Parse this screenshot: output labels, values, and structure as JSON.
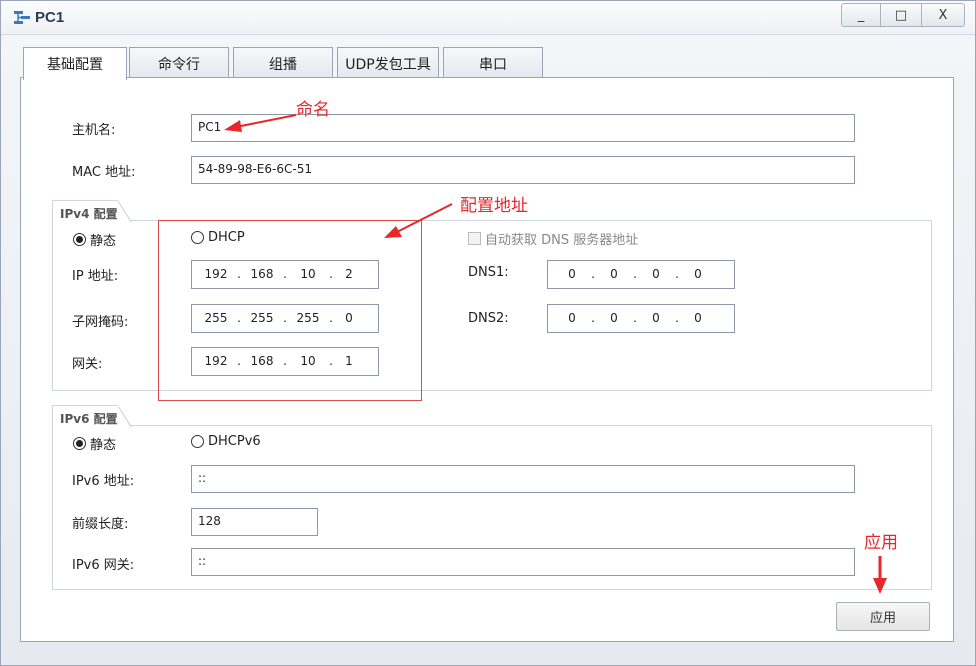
{
  "window": {
    "title": "PC1",
    "minimize": "_",
    "maximize": "□",
    "close": "X"
  },
  "tabs": [
    "基础配置",
    "命令行",
    "组播",
    "UDP发包工具",
    "串口"
  ],
  "basic": {
    "hostname_label": "主机名:",
    "hostname_value": "PC1",
    "mac_label": "MAC 地址:",
    "mac_value": "54-89-98-E6-6C-51"
  },
  "ipv4": {
    "group_title": "IPv4 配置",
    "static_label": "静态",
    "dhcp_label": "DHCP",
    "auto_dns_label": "自动获取 DNS 服务器地址",
    "ip_label": "IP 地址:",
    "ip": [
      "192",
      "168",
      "10",
      "2"
    ],
    "mask_label": "子网掩码:",
    "mask": [
      "255",
      "255",
      "255",
      "0"
    ],
    "gateway_label": "网关:",
    "gateway": [
      "192",
      "168",
      "10",
      "1"
    ],
    "dns1_label": "DNS1:",
    "dns1": [
      "0",
      "0",
      "0",
      "0"
    ],
    "dns2_label": "DNS2:",
    "dns2": [
      "0",
      "0",
      "0",
      "0"
    ]
  },
  "ipv6": {
    "group_title": "IPv6 配置",
    "static_label": "静态",
    "dhcp_label": "DHCPv6",
    "addr_label": "IPv6 地址:",
    "addr_value": "::",
    "prefix_label": "前缀长度:",
    "prefix_value": "128",
    "gw_label": "IPv6 网关:",
    "gw_value": "::"
  },
  "apply_label": "应用",
  "annotations": {
    "name": "命名",
    "config_addr": "配置地址",
    "apply": "应用"
  },
  "colors": {
    "annotation": "#e8272b",
    "accent": "#2a3b5a"
  }
}
